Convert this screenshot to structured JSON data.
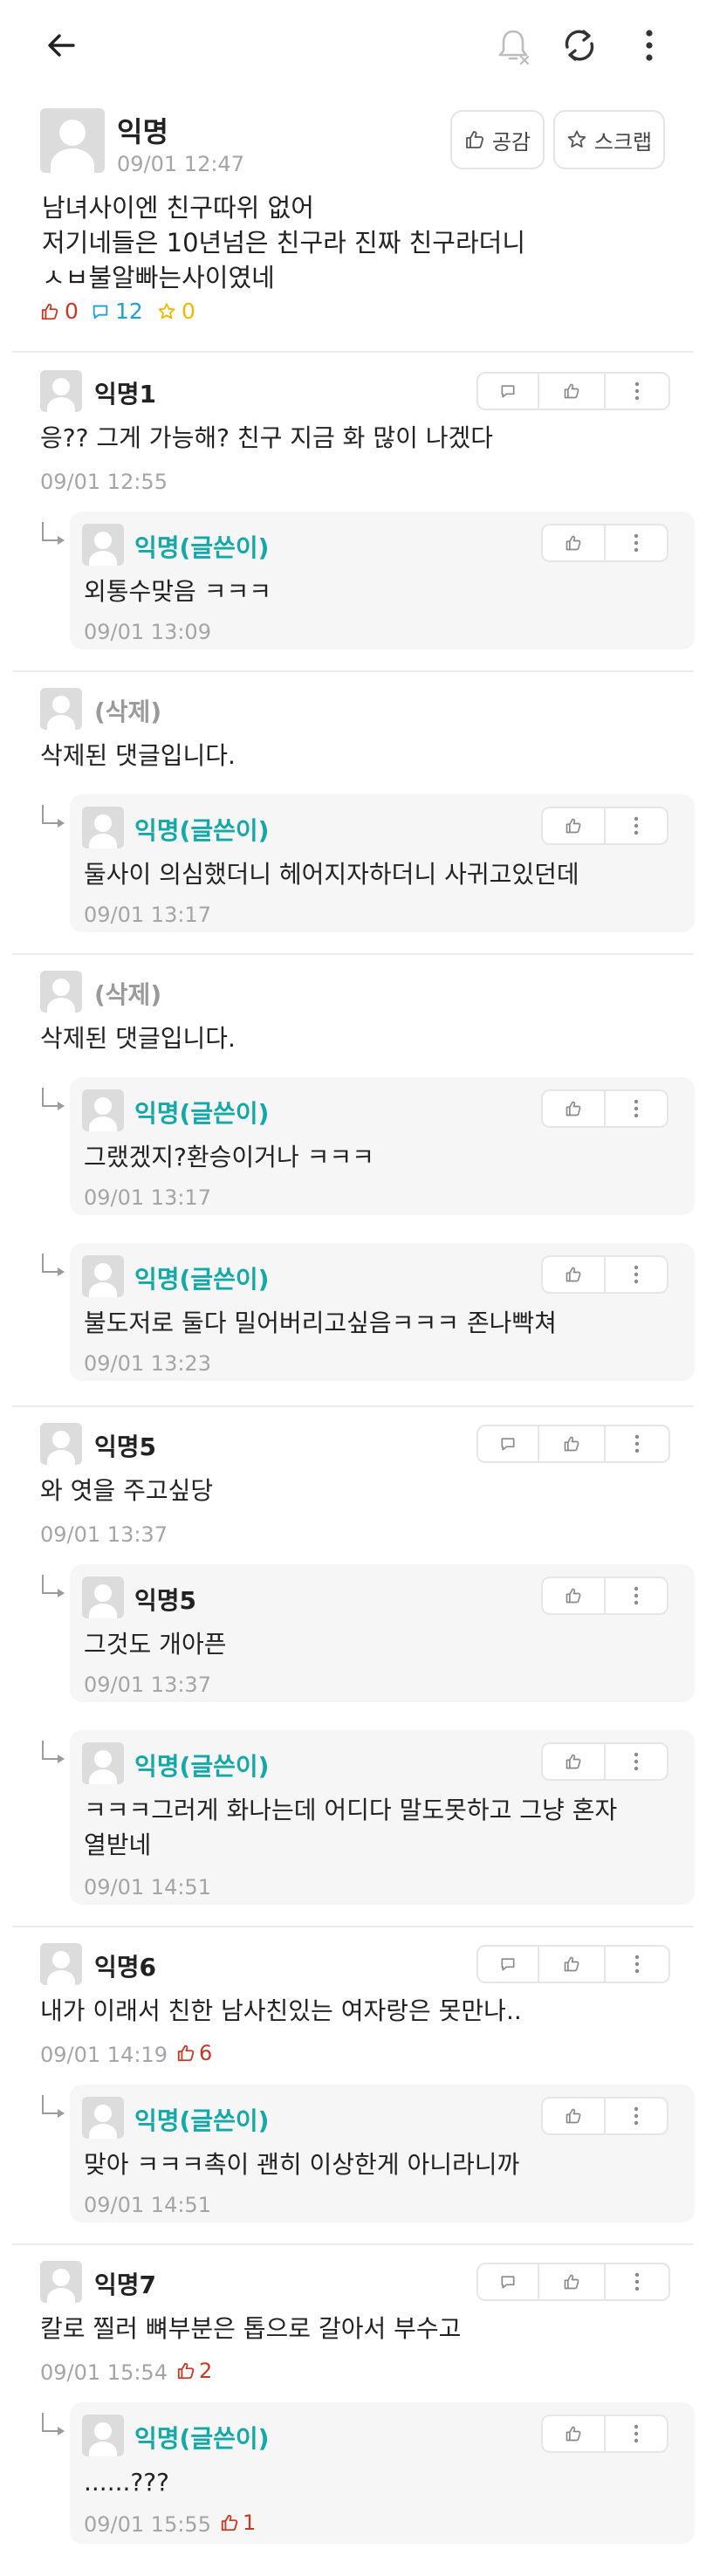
{
  "post": {
    "author": "익명",
    "time": "09/01 12:47",
    "like_button": "공감",
    "scrap_button": "스크랩",
    "lines": [
      "남녀사이엔 친구따위 없어",
      "저기네들은 10년넘은 친구라 진짜 친구라더니",
      "ㅅㅂ불알빠는사이였네"
    ],
    "likes": "0",
    "comments": "12",
    "scraps": "0"
  },
  "comments": [
    {
      "author": "익명1",
      "text": "응?? 그게 가능해? 친구 지금 화 많이 나겠다",
      "time": "09/01 12:55",
      "replies": [
        {
          "author": "익명(글쓴이)",
          "text": "외통수맞음 ㅋㅋㅋ",
          "time": "09/01 13:09"
        }
      ]
    },
    {
      "author": "(삭제)",
      "text": "삭제된 댓글입니다.",
      "replies": [
        {
          "author": "익명(글쓴이)",
          "text": "둘사이 의심했더니 헤어지자하더니 사귀고있던데",
          "time": "09/01 13:17"
        }
      ]
    },
    {
      "author": "(삭제)",
      "text": "삭제된 댓글입니다.",
      "replies": [
        {
          "author": "익명(글쓴이)",
          "text": "그랬겠지?환승이거나 ㅋㅋㅋ",
          "time": "09/01 13:17"
        },
        {
          "author": "익명(글쓴이)",
          "text": "불도저로 둘다 밀어버리고싶음ㅋㅋㅋ 존나빡쳐",
          "time": "09/01 13:23"
        }
      ]
    },
    {
      "author": "익명5",
      "text": "와 엿을 주고싶당",
      "time": "09/01 13:37",
      "replies": [
        {
          "author": "익명5",
          "text": "그것도 개아픈",
          "time": "09/01 13:37"
        },
        {
          "author": "익명(글쓴이)",
          "text_lines": [
            "ㅋㅋㅋ그러게 화나는데 어디다 말도못하고 그냥 혼자",
            "열받네"
          ],
          "time": "09/01 14:51"
        }
      ]
    },
    {
      "author": "익명6",
      "text": "내가 이래서 친한 남사친있는 여자랑은 못만나..",
      "time": "09/01 14:19",
      "likes": "6",
      "replies": [
        {
          "author": "익명(글쓴이)",
          "text": "맞아 ㅋㅋㅋ촉이 괜히 이상한게 아니라니까",
          "time": "09/01 14:51"
        }
      ]
    },
    {
      "author": "익명7",
      "text": "칼로 찔러 뼈부분은 톱으로 갈아서 부수고",
      "time": "09/01 15:54",
      "likes": "2",
      "replies": [
        {
          "author": "익명(글쓴이)",
          "text": "......???",
          "time": "09/01 15:55",
          "likes": "1"
        }
      ]
    }
  ],
  "colors": {
    "op_author": "#14a8a8",
    "like_red": "#c23b22",
    "comment_blue": "#1e9fd6",
    "scrap_yellow": "#f2b700"
  },
  "icons": [
    "back-arrow-icon",
    "notification-off-icon",
    "refresh-icon",
    "more-vertical-icon",
    "thumbs-up-icon",
    "chat-bubble-icon",
    "star-icon",
    "reply-arrow-icon"
  ]
}
